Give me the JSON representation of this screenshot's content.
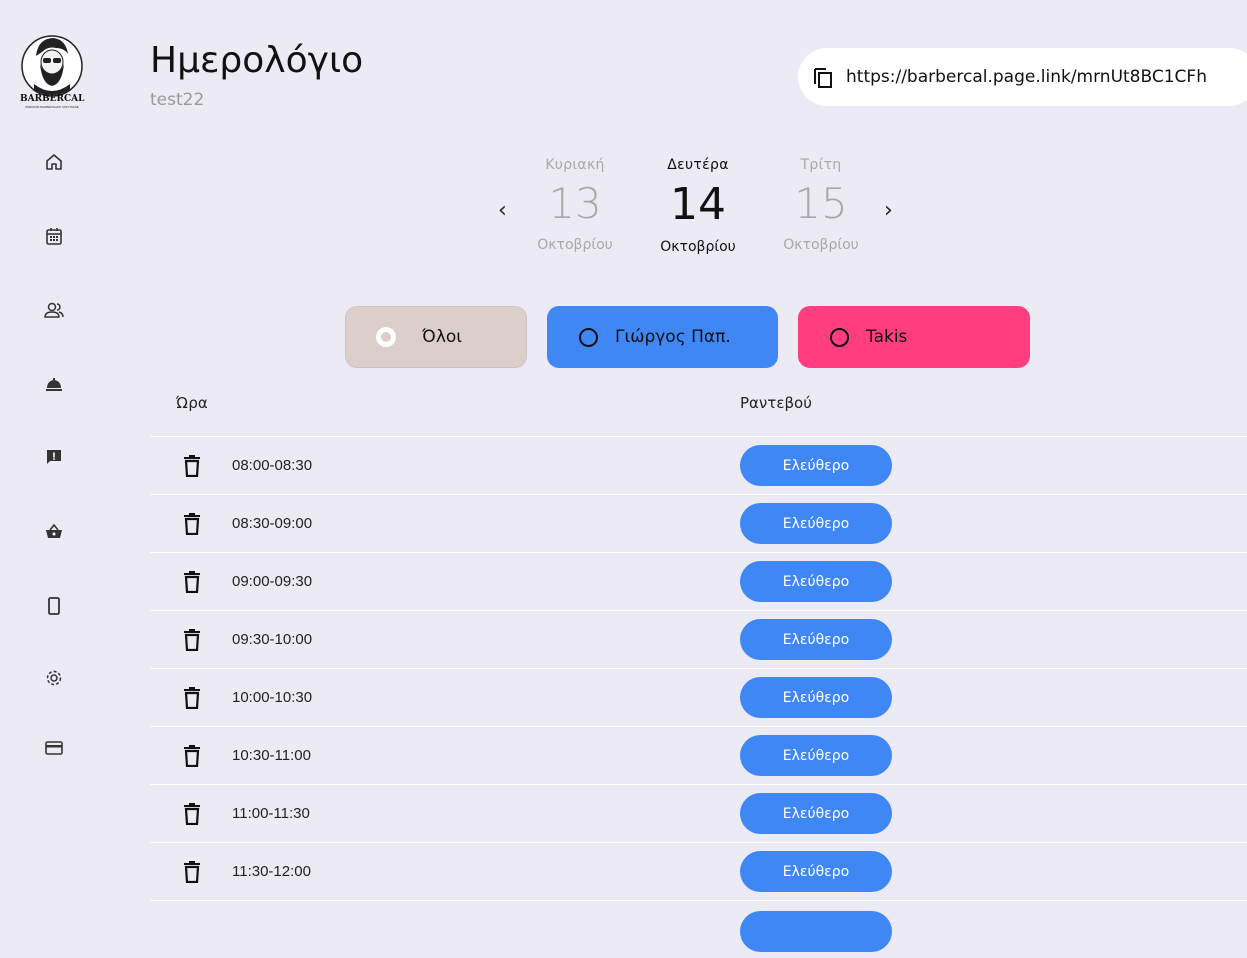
{
  "logo": {
    "text": "BARBERCAL",
    "tagline": "PREMIUM BARBERSHOP SOFTWARE"
  },
  "sidebar": {
    "items": [
      {
        "icon": "home-icon"
      },
      {
        "icon": "calendar-icon"
      },
      {
        "icon": "users-icon"
      },
      {
        "icon": "service-bell-icon"
      },
      {
        "icon": "feedback-icon"
      },
      {
        "icon": "basket-icon"
      },
      {
        "icon": "phone-icon"
      },
      {
        "icon": "gear-icon"
      },
      {
        "icon": "card-icon"
      }
    ]
  },
  "header": {
    "title": "Ημερολόγιο",
    "subtitle": "test22",
    "link": "https://barbercal.page.link/mrnUt8BC1CFh"
  },
  "days": [
    {
      "name": "Κυριακή",
      "number": "13",
      "month": "Οκτοβρίου",
      "active": false
    },
    {
      "name": "Δευτέρα",
      "number": "14",
      "month": "Οκτοβρίου",
      "active": true
    },
    {
      "name": "Τρίτη",
      "number": "15",
      "month": "Οκτοβρίου",
      "active": false
    }
  ],
  "nav": {
    "prev": "‹",
    "next": "›"
  },
  "filters": [
    {
      "label": "Όλοι",
      "color": "#dbcecb",
      "selected": true
    },
    {
      "label": "Γιώργος Παπ.",
      "color": "#3f87f5",
      "selected": false
    },
    {
      "label": "Takis",
      "color": "#ff3d7f",
      "selected": false
    }
  ],
  "table": {
    "col_time": "Ώρα",
    "col_appt": "Ραντεβού",
    "rows": [
      {
        "time": "08:00-08:30",
        "status": "Ελεύθερο"
      },
      {
        "time": "08:30-09:00",
        "status": "Ελεύθερο"
      },
      {
        "time": "09:00-09:30",
        "status": "Ελεύθερο"
      },
      {
        "time": "09:30-10:00",
        "status": "Ελεύθερο"
      },
      {
        "time": "10:00-10:30",
        "status": "Ελεύθερο"
      },
      {
        "time": "10:30-11:00",
        "status": "Ελεύθερο"
      },
      {
        "time": "11:00-11:30",
        "status": "Ελεύθερο"
      },
      {
        "time": "11:30-12:00",
        "status": "Ελεύθερο"
      }
    ]
  },
  "colors": {
    "accent": "#3f87f5",
    "background": "#ecebf5",
    "pink": "#ff3d7f"
  }
}
